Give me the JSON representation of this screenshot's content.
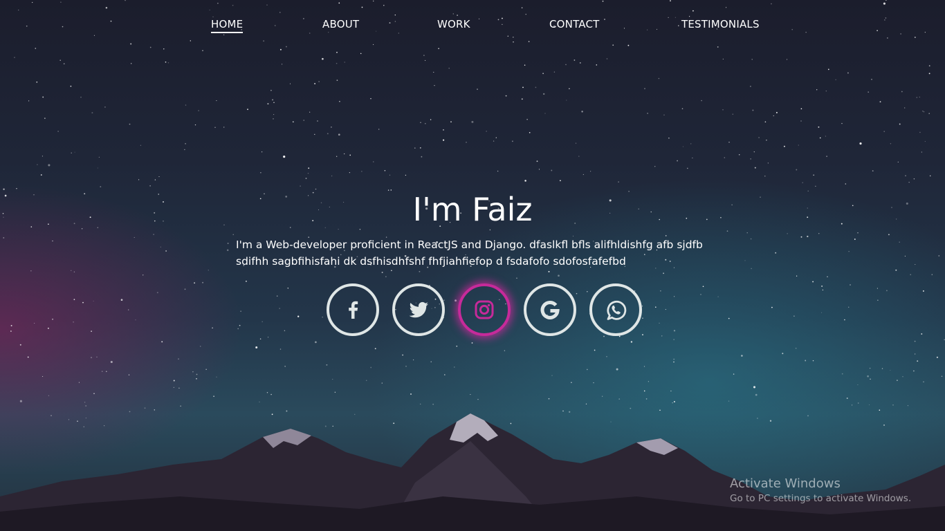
{
  "nav": {
    "items": [
      {
        "label": "HOME",
        "active": true
      },
      {
        "label": "ABOUT",
        "active": false
      },
      {
        "label": "WORK",
        "active": false
      },
      {
        "label": "CONTACT",
        "active": false
      },
      {
        "label": "TESTIMONIALS",
        "active": false
      }
    ]
  },
  "hero": {
    "title": "I'm Faiz",
    "description": "I'm a Web-developer proficient in ReactJS and Django. dfaslkfl bfls alifhldishfg afb sjdfb sdifhh sagbfihisfahi dk dsfhisdhfshf fhfjiahfiefop d fsdafofo sdofosfafefbd"
  },
  "socials": [
    {
      "icon": "facebook-icon",
      "active": false
    },
    {
      "icon": "twitter-icon",
      "active": false
    },
    {
      "icon": "instagram-icon",
      "active": true
    },
    {
      "icon": "google-icon",
      "active": false
    },
    {
      "icon": "whatsapp-icon",
      "active": false
    }
  ],
  "colors": {
    "accent": "#c62a9a",
    "icon": "#dfe6e6",
    "text": "#ffffff"
  },
  "watermark": {
    "title": "Activate Windows",
    "subtitle": "Go to PC settings to activate Windows."
  }
}
